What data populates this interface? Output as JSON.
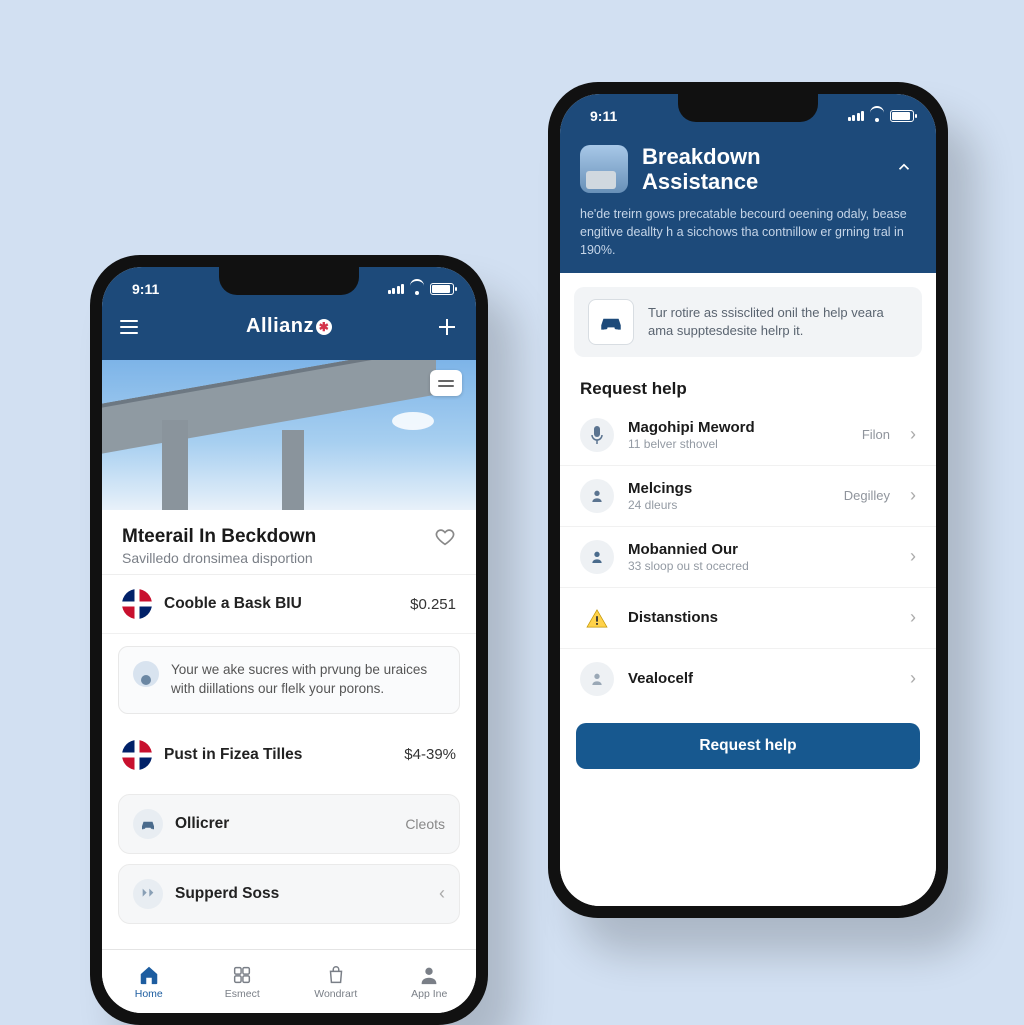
{
  "status": {
    "time": "9:11"
  },
  "phone1": {
    "brand": "Allianz",
    "main": {
      "title": "Mteerail In Beckdown",
      "subtitle": "Savilledo dronsimea disportion"
    },
    "rows": [
      {
        "title": "Cooble a Bask BIU",
        "value": "$0.251"
      },
      {
        "title": "Pust in Fizea Tilles",
        "value": "$4-39%"
      }
    ],
    "info": "Your we ake sucres with prvung be uraices with diillations our flelk your porons.",
    "tiles": [
      {
        "title": "Ollicrer",
        "meta": "Cleots"
      },
      {
        "title": "Supperd Soss",
        "meta": ""
      }
    ],
    "tabs": [
      {
        "label": "Home"
      },
      {
        "label": "Esmect"
      },
      {
        "label": "Wondrart"
      },
      {
        "label": "App Ine"
      }
    ]
  },
  "phone2": {
    "title": "Breakdown Assistance",
    "desc": "he'de treirn gows precatable becourd oeening odaly, bease engitive deallty h a sicchows tha contnillow er grning tral in 190%.",
    "notice": "Tur rotire as ssisclited onil the help veara ama supptesdesite helrp it.",
    "section": "Request help",
    "items": [
      {
        "title": "Magohipi Meword",
        "sub": "11 belver sthovel",
        "meta": "Filon",
        "icon": "mic"
      },
      {
        "title": "Melcings",
        "sub": "24 dleurs",
        "meta": "Degilley",
        "icon": "person"
      },
      {
        "title": "Mobannied Our",
        "sub": "33 sloop ou st ocecred",
        "meta": "",
        "icon": "person"
      },
      {
        "title": "Distanstions",
        "sub": "",
        "meta": "",
        "icon": "warn"
      },
      {
        "title": "Vealocelf",
        "sub": "",
        "meta": "",
        "icon": "person"
      }
    ],
    "cta": "Request help"
  }
}
